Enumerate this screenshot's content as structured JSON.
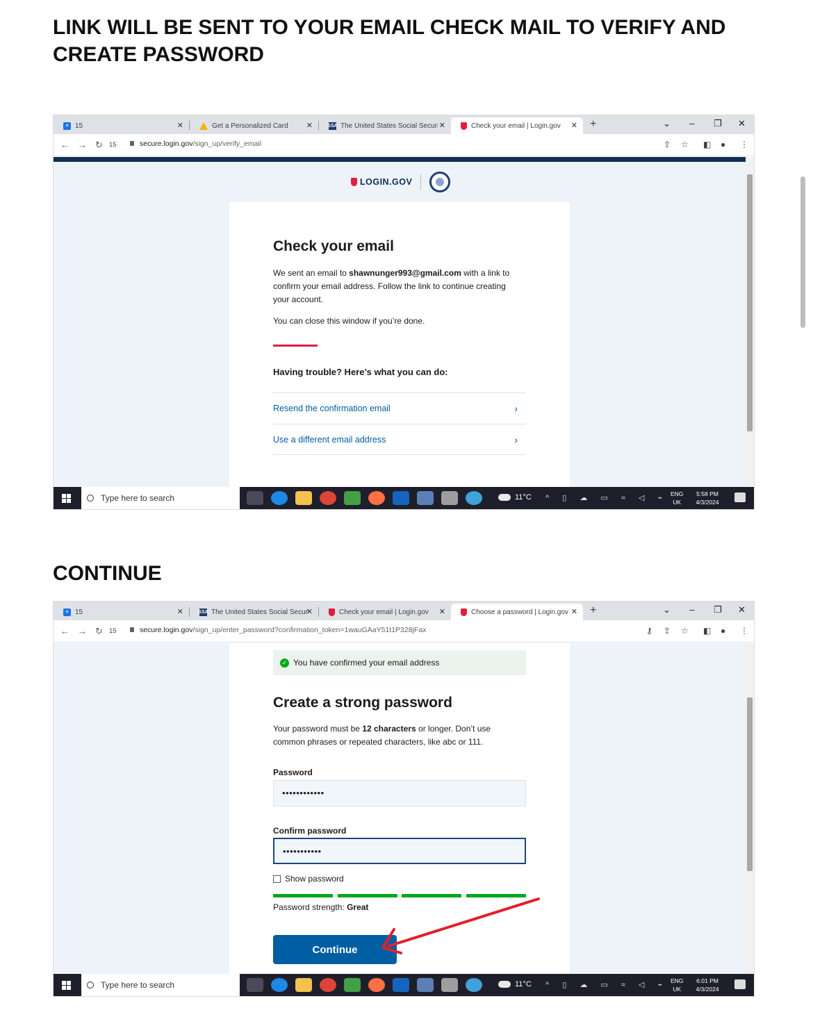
{
  "instructions": {
    "step1": "LINK WILL BE SENT TO YOUR EMAIL CHECK MAIL TO VERIFY AND CREATE PASSWORD",
    "step2": "CONTINUE"
  },
  "screenshot1": {
    "tabs": [
      {
        "label": "15"
      },
      {
        "label": "Get a Personalized Card"
      },
      {
        "label": "The United States Social Securit"
      },
      {
        "label": "Check your email | Login.gov"
      }
    ],
    "url_host": "secure.login.gov",
    "url_path": "/sign_up/verify_email",
    "reload_count": "15",
    "brand": "LOGIN.GOV",
    "title": "Check your email",
    "body_prefix": "We sent an email to ",
    "email": "shawnunger993@gmail.com",
    "body_suffix": " with a link to confirm your email address. Follow the link to continue creating your account.",
    "close_note": "You can close this window if you’re done.",
    "trouble_heading": "Having trouble? Here’s what you can do:",
    "options": [
      {
        "label": "Resend the confirmation email"
      },
      {
        "label": "Use a different email address"
      }
    ],
    "taskbar": {
      "search_placeholder": "Type here to search",
      "weather": "11°C",
      "lang1": "ENG",
      "lang2": "UK",
      "time": "5:58 PM",
      "date": "4/3/2024"
    }
  },
  "screenshot2": {
    "tabs": [
      {
        "label": "15"
      },
      {
        "label": "The United States Social Securit"
      },
      {
        "label": "Check your email | Login.gov"
      },
      {
        "label": "Choose a password | Login.gov"
      }
    ],
    "url_host": "secure.login.gov",
    "url_path": "/sign_up/enter_password?confirmation_token=1wauGAaY51t1P328jFax",
    "reload_count": "15",
    "alert": "You have confirmed your email address",
    "title": "Create a strong password",
    "req_prefix": "Your password must be ",
    "req_bold": "12 characters",
    "req_suffix": " or longer. Don’t use common phrases or repeated characters, like abc or 111.",
    "password_label": "Password",
    "password_value": "••••••••••••",
    "confirm_label": "Confirm password",
    "confirm_value": "•••••••••••",
    "show_password": "Show password",
    "strength_prefix": "Password strength: ",
    "strength_value": "Great",
    "continue_label": "Continue",
    "taskbar": {
      "search_placeholder": "Type here to search",
      "weather": "11°C",
      "lang1": "ENG",
      "lang2": "UK",
      "time": "6:01 PM",
      "date": "4/3/2024"
    }
  },
  "colors": {
    "annotation_arrow": "#e0202e",
    "login_blue": "#005ea2",
    "success_green": "#00a91c"
  }
}
